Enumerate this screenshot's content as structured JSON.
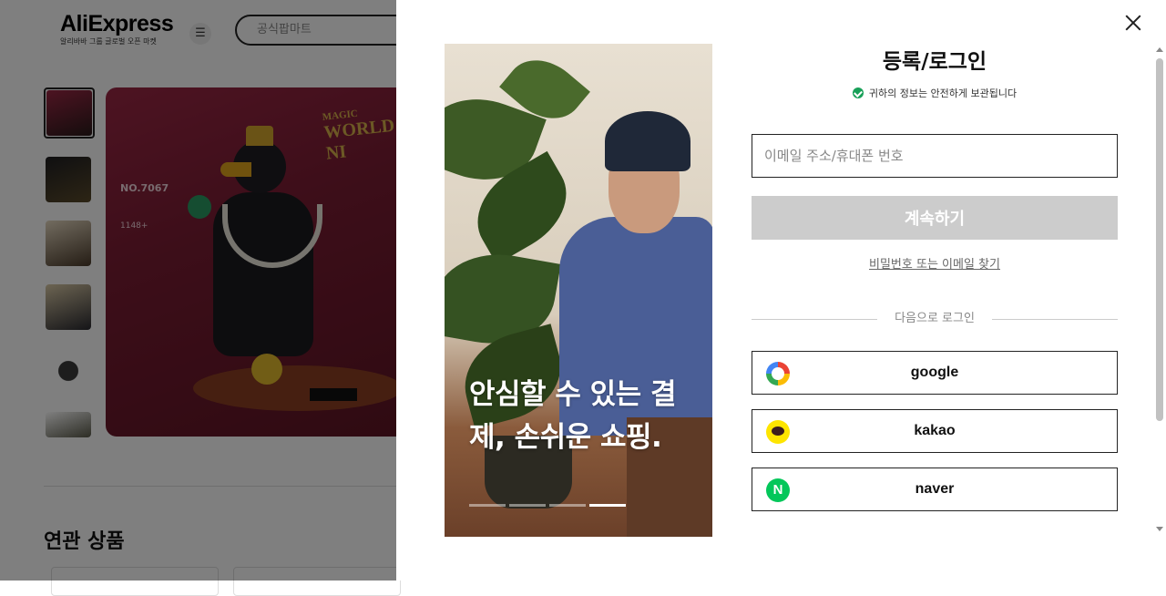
{
  "background_page": {
    "brand": "AliExpress",
    "tagline": "알리바바 그룹 글로벌 오픈 마켓",
    "search_placeholder": "공식팝마트",
    "product_image": {
      "art_small": "MAGIC",
      "art_title": "WORLD NI",
      "model_no": "NO.7067",
      "piece_count": "1148+"
    },
    "related_title": "연관 상품"
  },
  "modal": {
    "title": "등록/로그인",
    "secure_note": "귀하의 정보는 안전하게 보관됩니다",
    "email_placeholder": "이메일 주소/휴대폰 번호",
    "continue_label": "계속하기",
    "forgot_link": "비밀번호 또는 이메일 찾기",
    "or_login_with": "다음으로 로그인",
    "social": [
      {
        "label": "google",
        "icon": "google-icon"
      },
      {
        "label": "kakao",
        "icon": "kakao-icon"
      },
      {
        "label": "naver",
        "icon": "naver-icon",
        "glyph": "N"
      }
    ],
    "banner": {
      "text": "안심할 수 있는 결제, 손쉬운 쇼핑.",
      "slides": 4,
      "active_slide": 4
    }
  },
  "colors": {
    "continue_disabled": "#cccccc",
    "secure_green": "#18a058",
    "kakao_yellow": "#fee500",
    "naver_green": "#03c75a"
  }
}
